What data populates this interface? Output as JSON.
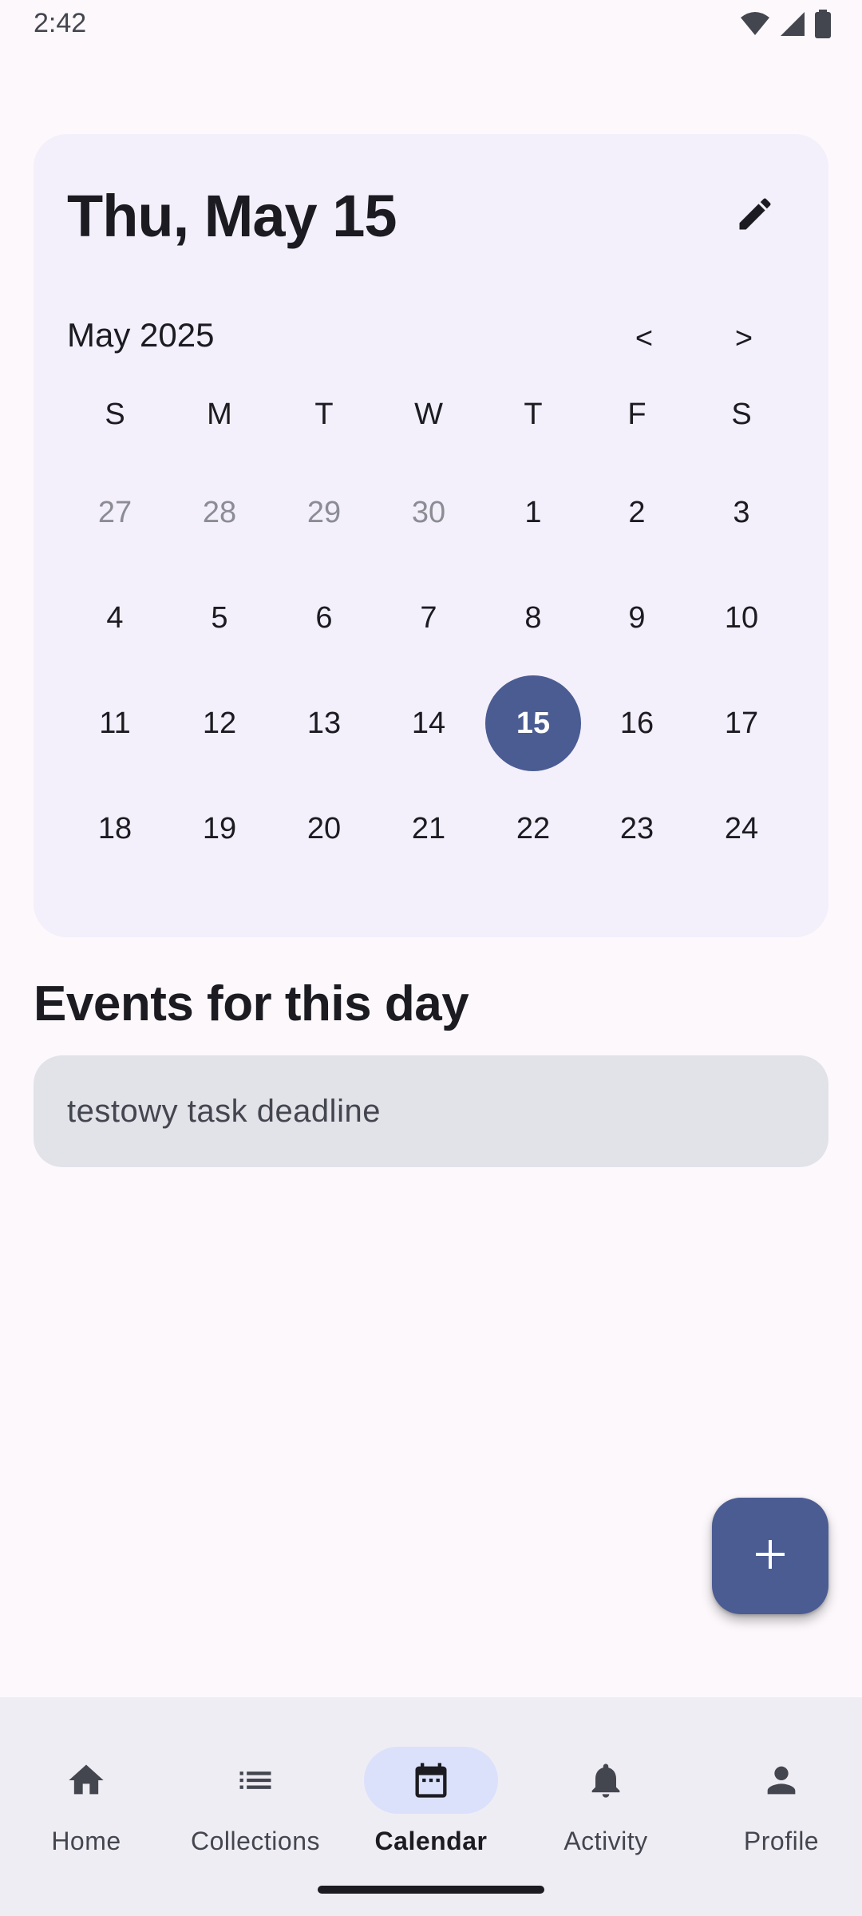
{
  "status_bar": {
    "time": "2:42",
    "icons": [
      "wifi-icon",
      "cellular-signal-icon",
      "battery-icon"
    ]
  },
  "date_picker": {
    "headline": "Thu, May 15",
    "edit_icon": "pencil-icon",
    "month_label": "May 2025",
    "prev_label": "<",
    "next_label": ">",
    "weekdays": [
      "S",
      "M",
      "T",
      "W",
      "T",
      "F",
      "S"
    ],
    "weeks": [
      [
        {
          "d": "27",
          "outside": true
        },
        {
          "d": "28",
          "outside": true
        },
        {
          "d": "29",
          "outside": true
        },
        {
          "d": "30",
          "outside": true
        },
        {
          "d": "1"
        },
        {
          "d": "2"
        },
        {
          "d": "3"
        }
      ],
      [
        {
          "d": "4"
        },
        {
          "d": "5"
        },
        {
          "d": "6"
        },
        {
          "d": "7"
        },
        {
          "d": "8"
        },
        {
          "d": "9"
        },
        {
          "d": "10"
        }
      ],
      [
        {
          "d": "11"
        },
        {
          "d": "12"
        },
        {
          "d": "13"
        },
        {
          "d": "14"
        },
        {
          "d": "15",
          "selected": true
        },
        {
          "d": "16"
        },
        {
          "d": "17"
        }
      ],
      [
        {
          "d": "18"
        },
        {
          "d": "19"
        },
        {
          "d": "20"
        },
        {
          "d": "21"
        },
        {
          "d": "22"
        },
        {
          "d": "23"
        },
        {
          "d": "24"
        }
      ]
    ],
    "selected_day": "15"
  },
  "events": {
    "title": "Events for this day",
    "items": [
      {
        "label": "testowy task deadline"
      }
    ]
  },
  "fab": {
    "icon": "plus-icon"
  },
  "bottom_nav": {
    "items": [
      {
        "label": "Home",
        "icon": "home-icon",
        "active": false
      },
      {
        "label": "Collections",
        "icon": "list-icon",
        "active": false
      },
      {
        "label": "Calendar",
        "icon": "calendar-icon",
        "active": true
      },
      {
        "label": "Activity",
        "icon": "bell-icon",
        "active": false
      },
      {
        "label": "Profile",
        "icon": "person-icon",
        "active": false
      }
    ]
  },
  "colors": {
    "primary": "#4a5c92",
    "card_bg": "#f3effb",
    "event_bg": "#e2e2e9",
    "nav_bg": "#efedf4",
    "active_pill": "#dbe1fb"
  }
}
